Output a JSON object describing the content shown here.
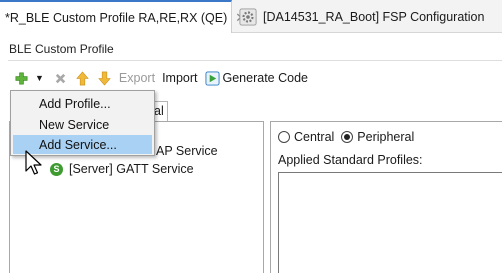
{
  "tabs": [
    {
      "label": "*R_BLE Custom Profile RA,RE,RX (QE)",
      "close": "✕"
    },
    {
      "label": "[DA14531_RA_Boot] FSP Configuration"
    }
  ],
  "editor": {
    "title": "BLE Custom Profile"
  },
  "toolbar": {
    "export_label": "Export",
    "import_label": "Import",
    "generate_label": "Generate Code",
    "caret": "▼"
  },
  "menu": {
    "items": [
      {
        "label": "Add Profile..."
      },
      {
        "label": "New Service"
      },
      {
        "label": "Add Service..."
      }
    ]
  },
  "tree": {
    "tab_fragment": "al",
    "gap_service_fragment": "AP Service",
    "gatt_service": "[Server] GATT Service",
    "service_badge": "S"
  },
  "role": {
    "central": "Central",
    "peripheral": "Peripheral",
    "selected": "Peripheral"
  },
  "applied_profiles_label": "Applied Standard Profiles:",
  "colors": {
    "accent": "#3c78c8",
    "menu_hover": "#a9d1f3",
    "service_badge": "#3d9b2f"
  }
}
